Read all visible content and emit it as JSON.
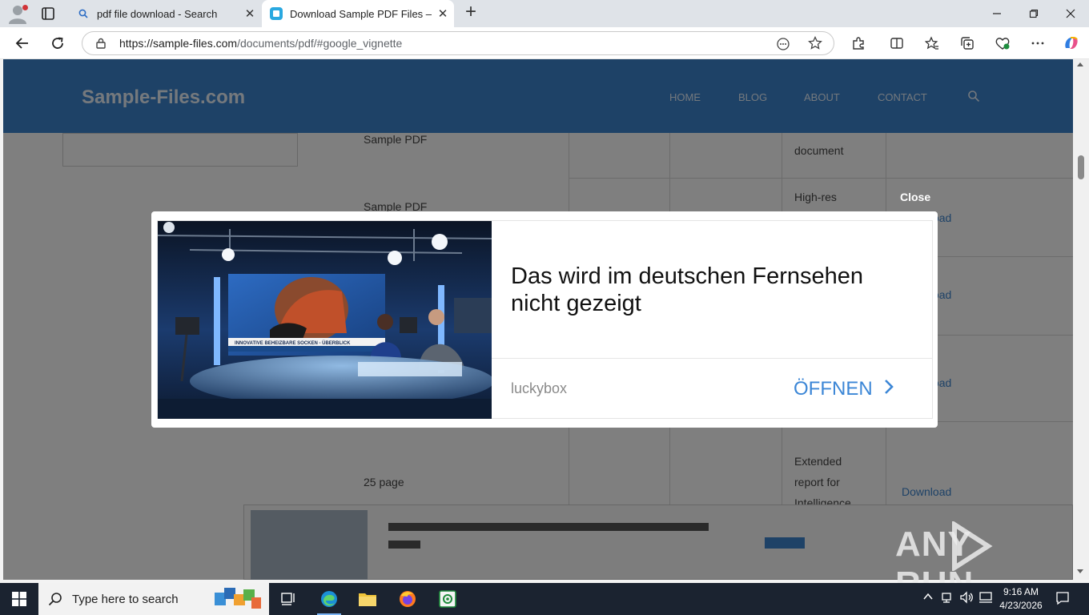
{
  "browser": {
    "tabs": [
      {
        "title": "pdf file download - Search",
        "icon": "search-icon"
      },
      {
        "title": "Download Sample PDF Files — Fr",
        "icon": "site-favicon"
      }
    ],
    "new_tab_label": "+",
    "address": {
      "url_host": "https://sample-files.com",
      "url_path": "/documents/pdf/#google_vignette"
    }
  },
  "site": {
    "logo": "Sample-Files.com",
    "nav": [
      "HOME",
      "BLOG",
      "ABOUT",
      "CONTACT"
    ],
    "background_text": [
      "Sample PDF",
      "Sample PDF",
      "document",
      "High-res",
      "Extended",
      "report for",
      "Intelligence",
      "25 page",
      "Download",
      "Download",
      "Download",
      "Download"
    ]
  },
  "ad": {
    "close_label": "Close",
    "headline": "Das wird im deutschen Fernsehen nicht gezeigt",
    "advertiser": "luckybox",
    "cta_label": "ÖFFNEN",
    "image_caption": "INNOVATIVE BEHEIZBARE SOCKEN - ÜBERBLICK"
  },
  "watermark": "ANY RUN",
  "taskbar": {
    "search_placeholder": "Type here to search",
    "time": "9:16 AM",
    "date": "4/23/2026"
  },
  "colors": {
    "site_header": "#3c84cf",
    "cta": "#3b86d6",
    "taskbar": "#1b2330"
  }
}
